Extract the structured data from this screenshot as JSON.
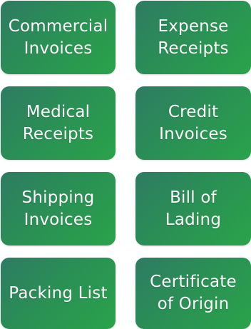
{
  "tiles": [
    {
      "label": "Commercial\nInvoices"
    },
    {
      "label": "Expense\nReceipts"
    },
    {
      "label": "Medical\nReceipts"
    },
    {
      "label": "Credit\nInvoices"
    },
    {
      "label": "Shipping\nInvoices"
    },
    {
      "label": "Bill of\nLading"
    },
    {
      "label": "Packing List"
    },
    {
      "label": "Certificate\nof Origin"
    }
  ],
  "colors": {
    "tile_start": "#2e7b63",
    "tile_mid": "#2a8f55",
    "tile_end": "#2aa34a",
    "text": "#ffffff",
    "background": "#ffffff"
  }
}
